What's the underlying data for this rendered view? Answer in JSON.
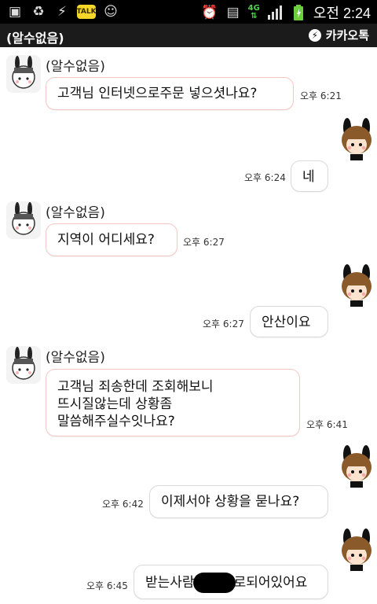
{
  "status_bar": {
    "time": "오전 2:24",
    "network": "4G",
    "icons_left": [
      "gallery-icon",
      "recycle-icon",
      "usb-icon",
      "kakaotalk-notification-icon",
      "people-icon"
    ],
    "icons_right": [
      "alarm-icon",
      "data-icon",
      "signal-icon",
      "battery-icon"
    ],
    "talk_badge": "TALK"
  },
  "header": {
    "title": "(알수없음)",
    "brand": "카카오톡"
  },
  "messages": [
    {
      "side": "left",
      "sender": "(알수없음)",
      "text": "고객님 인터넷으로주문 넣으셧나요?",
      "time": "오후 6:21"
    },
    {
      "side": "right",
      "text": "네",
      "time": "오후 6:24"
    },
    {
      "side": "left",
      "sender": "(알수없음)",
      "text": "지역이 어디세요?",
      "time": "오후 6:27"
    },
    {
      "side": "right",
      "text": "안산이요",
      "time": "오후 6:27"
    },
    {
      "side": "left",
      "sender": "(알수없음)",
      "lines": [
        "고객님 죄송한데 조회해보니",
        "뜨시질않는데 상황좀",
        "말씀해주실수잇나요?"
      ],
      "time": "오후 6:41"
    },
    {
      "side": "right",
      "text": "이제서야 상황을 묻나요?",
      "time": "오후 6:42"
    },
    {
      "side": "right",
      "text_before": "받는사람",
      "text_after": "로되어있어요",
      "time": "오후 6:45"
    }
  ]
}
